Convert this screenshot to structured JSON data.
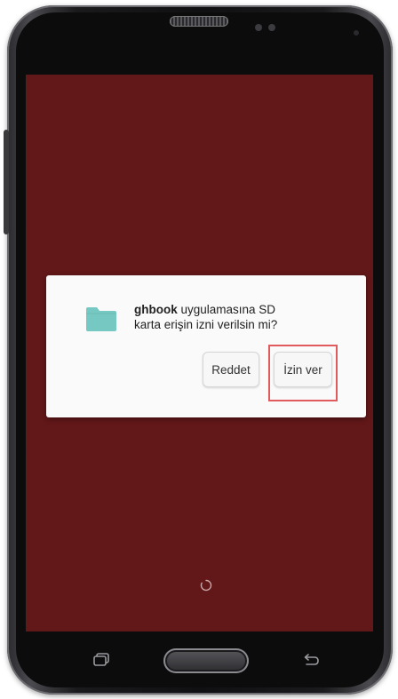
{
  "dialog": {
    "app_name": "ghbook",
    "message_rest_line1": " uygulamasına SD",
    "message_line2": "karta erişin izni verilsin mi?",
    "deny_label": "Reddet",
    "allow_label": "İzin ver"
  },
  "colors": {
    "screen_background": "#621718",
    "dialog_background": "#fafafa",
    "folder_icon": "#76c9c2",
    "highlight_border": "#e05a5e"
  },
  "icons": {
    "dialog": "folder-icon",
    "loading": "spinner-icon",
    "nav_left": "recent-apps-icon",
    "nav_center": "home-button",
    "nav_right": "back-icon"
  }
}
